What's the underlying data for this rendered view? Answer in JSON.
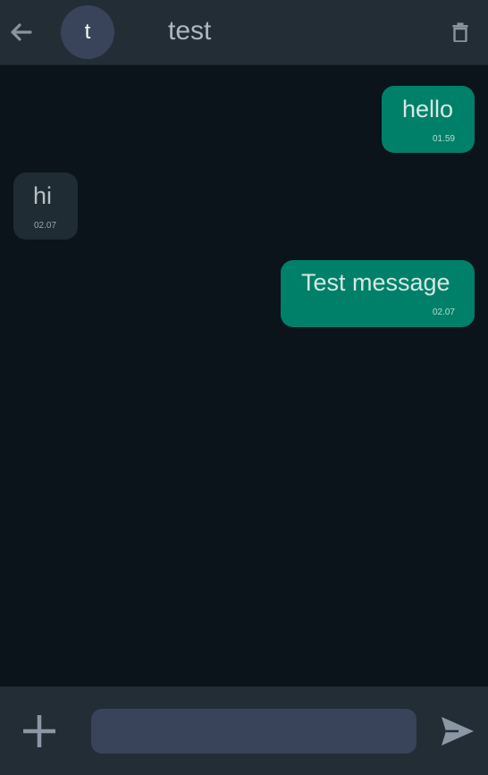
{
  "header": {
    "back_icon": "arrow-left-icon",
    "avatar_initial": "t",
    "title": "test",
    "delete_icon": "trash-icon"
  },
  "messages": [
    {
      "direction": "outgoing",
      "text": "hello",
      "time": "01.59"
    },
    {
      "direction": "incoming",
      "text": "hi",
      "time": "02.07"
    },
    {
      "direction": "outgoing",
      "text": "Test message",
      "time": "02.07"
    }
  ],
  "composer": {
    "add_icon": "plus-icon",
    "input_value": "",
    "input_placeholder": "",
    "send_icon": "send-icon"
  },
  "colors": {
    "header_bg": "#222d35",
    "chat_bg": "#0b131b",
    "outgoing_bubble": "#008069",
    "incoming_bubble": "#1f2c33",
    "avatar_bg": "#39445a",
    "input_bg": "#39445a"
  }
}
